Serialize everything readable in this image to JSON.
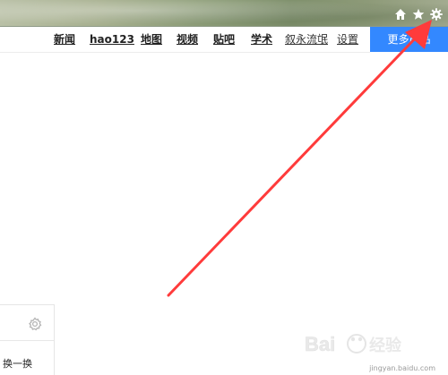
{
  "browser": {
    "icons": [
      "home-icon",
      "star-icon",
      "gear-icon"
    ]
  },
  "topnav": {
    "links": [
      {
        "label": "新闻",
        "bold": true
      },
      {
        "label": "hao123",
        "bold": true
      },
      {
        "label": "地图",
        "bold": true
      },
      {
        "label": "视频",
        "bold": true
      },
      {
        "label": "贴吧",
        "bold": true
      },
      {
        "label": "学术",
        "bold": true
      },
      {
        "label": "叙永流氓",
        "bold": false
      },
      {
        "label": "设置",
        "bold": false
      }
    ],
    "more_button": "更多产品"
  },
  "panel": {
    "refresh_label": "换一换",
    "settings_icon": "gear-icon"
  },
  "annotation": {
    "arrow_color": "#ff3b3b"
  },
  "watermark": {
    "brand": "Bai du 经验",
    "url": "jingyan.baidu.com"
  },
  "colors": {
    "accent": "#3388ff"
  }
}
